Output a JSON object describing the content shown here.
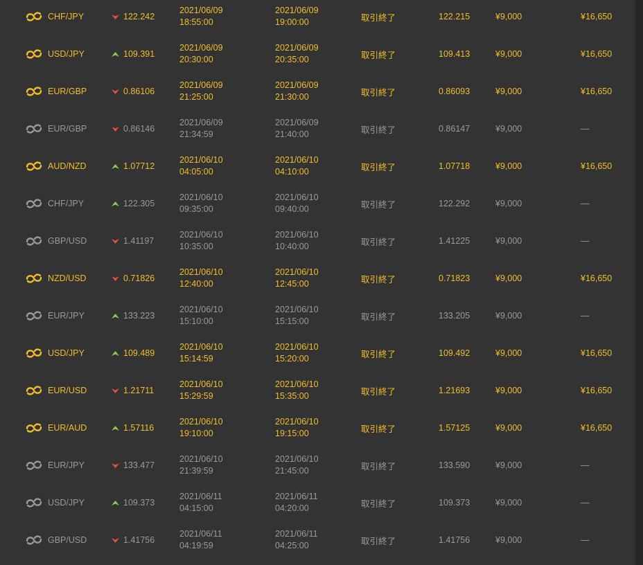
{
  "colors": {
    "win_text": "#f3be2c",
    "lose_text": "#9a9a9a",
    "up_arrow": "#8fd14f",
    "down_arrow": "#e8533f",
    "panel_bg": "#333333"
  },
  "icons": {
    "pair": "currency-exchange-icon",
    "up": "arrow-up-icon",
    "down": "arrow-down-icon"
  },
  "trades": [
    {
      "result": "win",
      "pair": "CHF/JPY",
      "direction": "down",
      "open_rate": "122.242",
      "start_date": "2021/06/09",
      "start_time": "18:55:00",
      "end_date": "2021/06/09",
      "end_time": "19:00:00",
      "status": "取引終了",
      "close_rate": "122.215",
      "amount": "¥9,000",
      "payout": "¥16,650"
    },
    {
      "result": "win",
      "pair": "USD/JPY",
      "direction": "up",
      "open_rate": "109.391",
      "start_date": "2021/06/09",
      "start_time": "20:30:00",
      "end_date": "2021/06/09",
      "end_time": "20:35:00",
      "status": "取引終了",
      "close_rate": "109.413",
      "amount": "¥9,000",
      "payout": "¥16,650"
    },
    {
      "result": "win",
      "pair": "EUR/GBP",
      "direction": "down",
      "open_rate": "0.86106",
      "start_date": "2021/06/09",
      "start_time": "21:25:00",
      "end_date": "2021/06/09",
      "end_time": "21:30:00",
      "status": "取引終了",
      "close_rate": "0.86093",
      "amount": "¥9,000",
      "payout": "¥16,650"
    },
    {
      "result": "lose",
      "pair": "EUR/GBP",
      "direction": "down",
      "open_rate": "0.86146",
      "start_date": "2021/06/09",
      "start_time": "21:34:59",
      "end_date": "2021/06/09",
      "end_time": "21:40:00",
      "status": "取引終了",
      "close_rate": "0.86147",
      "amount": "¥9,000",
      "payout": "—"
    },
    {
      "result": "win",
      "pair": "AUD/NZD",
      "direction": "up",
      "open_rate": "1.07712",
      "start_date": "2021/06/10",
      "start_time": "04:05:00",
      "end_date": "2021/06/10",
      "end_time": "04:10:00",
      "status": "取引終了",
      "close_rate": "1.07718",
      "amount": "¥9,000",
      "payout": "¥16,650"
    },
    {
      "result": "lose",
      "pair": "CHF/JPY",
      "direction": "up",
      "open_rate": "122.305",
      "start_date": "2021/06/10",
      "start_time": "09:35:00",
      "end_date": "2021/06/10",
      "end_time": "09:40:00",
      "status": "取引終了",
      "close_rate": "122.292",
      "amount": "¥9,000",
      "payout": "—"
    },
    {
      "result": "lose",
      "pair": "GBP/USD",
      "direction": "down",
      "open_rate": "1.41197",
      "start_date": "2021/06/10",
      "start_time": "10:35:00",
      "end_date": "2021/06/10",
      "end_time": "10:40:00",
      "status": "取引終了",
      "close_rate": "1.41225",
      "amount": "¥9,000",
      "payout": "—"
    },
    {
      "result": "win",
      "pair": "NZD/USD",
      "direction": "down",
      "open_rate": "0.71826",
      "start_date": "2021/06/10",
      "start_time": "12:40:00",
      "end_date": "2021/06/10",
      "end_time": "12:45:00",
      "status": "取引終了",
      "close_rate": "0.71823",
      "amount": "¥9,000",
      "payout": "¥16,650"
    },
    {
      "result": "lose",
      "pair": "EUR/JPY",
      "direction": "up",
      "open_rate": "133.223",
      "start_date": "2021/06/10",
      "start_time": "15:10:00",
      "end_date": "2021/06/10",
      "end_time": "15:15:00",
      "status": "取引終了",
      "close_rate": "133.205",
      "amount": "¥9,000",
      "payout": "—"
    },
    {
      "result": "win",
      "pair": "USD/JPY",
      "direction": "up",
      "open_rate": "109.489",
      "start_date": "2021/06/10",
      "start_time": "15:14:59",
      "end_date": "2021/06/10",
      "end_time": "15:20:00",
      "status": "取引終了",
      "close_rate": "109.492",
      "amount": "¥9,000",
      "payout": "¥16,650"
    },
    {
      "result": "win",
      "pair": "EUR/USD",
      "direction": "down",
      "open_rate": "1.21711",
      "start_date": "2021/06/10",
      "start_time": "15:29:59",
      "end_date": "2021/06/10",
      "end_time": "15:35:00",
      "status": "取引終了",
      "close_rate": "1.21693",
      "amount": "¥9,000",
      "payout": "¥16,650"
    },
    {
      "result": "win",
      "pair": "EUR/AUD",
      "direction": "up",
      "open_rate": "1.57116",
      "start_date": "2021/06/10",
      "start_time": "19:10:00",
      "end_date": "2021/06/10",
      "end_time": "19:15:00",
      "status": "取引終了",
      "close_rate": "1.57125",
      "amount": "¥9,000",
      "payout": "¥16,650"
    },
    {
      "result": "lose",
      "pair": "EUR/JPY",
      "direction": "down",
      "open_rate": "133.477",
      "start_date": "2021/06/10",
      "start_time": "21:39:59",
      "end_date": "2021/06/10",
      "end_time": "21:45:00",
      "status": "取引終了",
      "close_rate": "133.590",
      "amount": "¥9,000",
      "payout": "—"
    },
    {
      "result": "lose",
      "pair": "USD/JPY",
      "direction": "up",
      "open_rate": "109.373",
      "start_date": "2021/06/11",
      "start_time": "04:15:00",
      "end_date": "2021/06/11",
      "end_time": "04:20:00",
      "status": "取引終了",
      "close_rate": "109.373",
      "amount": "¥9,000",
      "payout": "—"
    },
    {
      "result": "lose",
      "pair": "GBP/USD",
      "direction": "down",
      "open_rate": "1.41756",
      "start_date": "2021/06/11",
      "start_time": "04:19:59",
      "end_date": "2021/06/11",
      "end_time": "04:25:00",
      "status": "取引終了",
      "close_rate": "1.41756",
      "amount": "¥9,000",
      "payout": "—"
    }
  ]
}
